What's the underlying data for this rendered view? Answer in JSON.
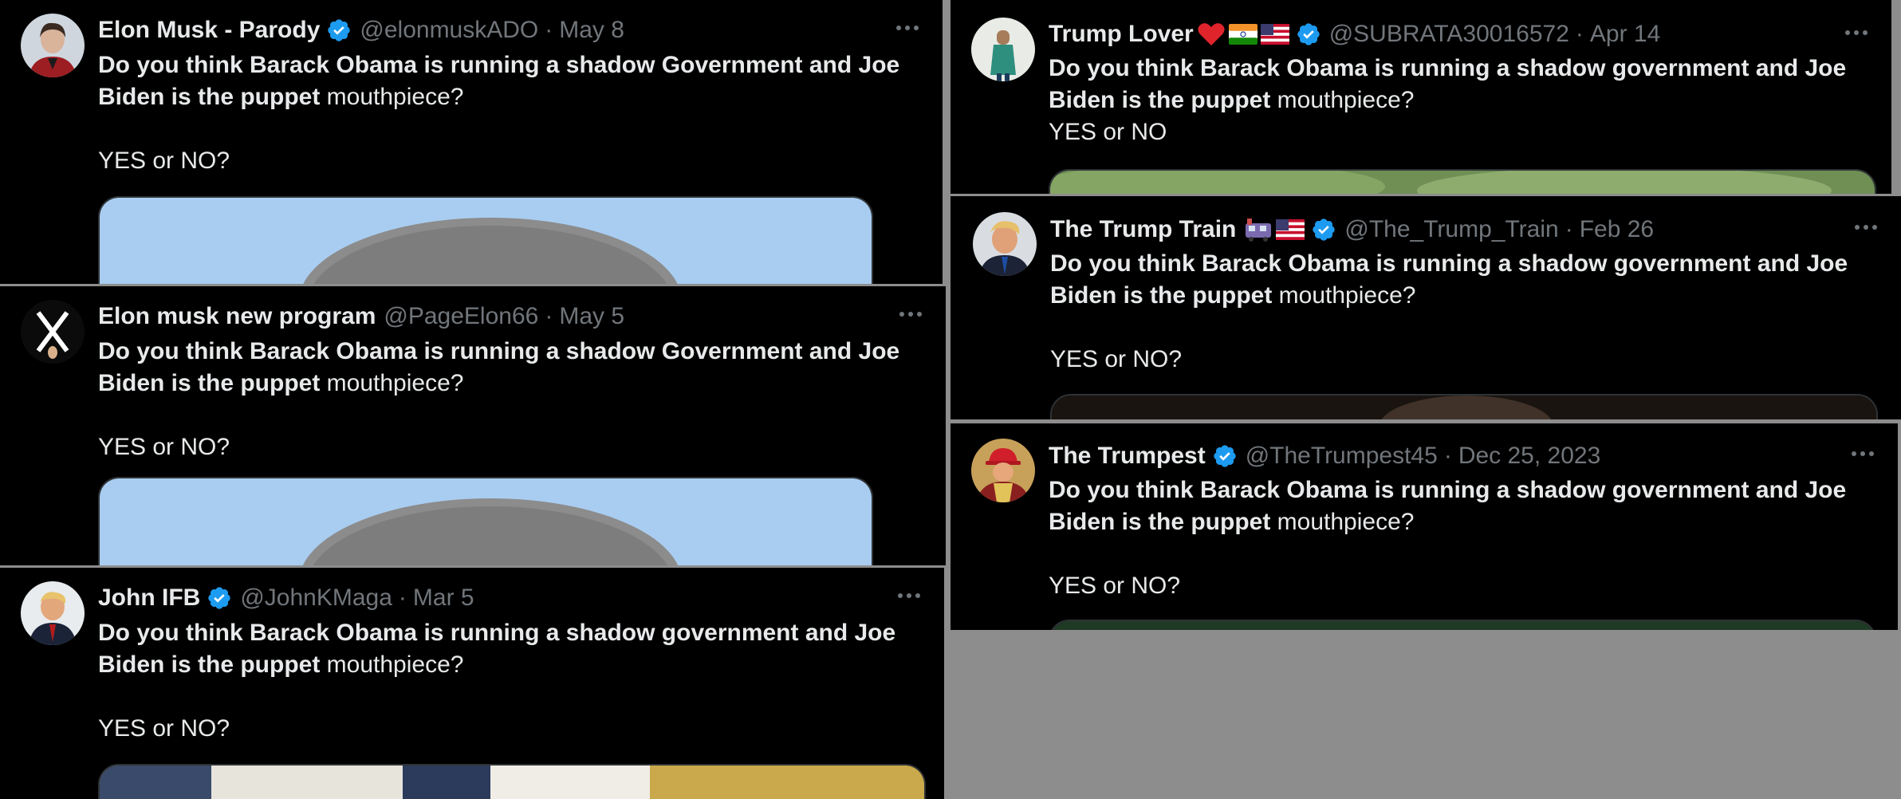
{
  "tweets": [
    {
      "name": "Elon Musk - Parody",
      "handle": "@elonmuskADO",
      "date": "May 8",
      "verified": true,
      "text_bold_1": "Do you think Barack Obama is running a shadow Government and Joe Biden is the puppet",
      "text_rest_1": " mouthpiece?",
      "text_2": "YES or NO?"
    },
    {
      "name": "Elon musk new program",
      "handle": "@PageElon66",
      "date": "May 5",
      "verified": false,
      "text_bold_1": "Do you think Barack Obama is running a shadow Government and Joe Biden is the puppet",
      "text_rest_1": " mouthpiece?",
      "text_2": "YES or NO?"
    },
    {
      "name": "John IFB",
      "handle": "@JohnKMaga",
      "date": "Mar 5",
      "verified": true,
      "text_bold_1": "Do you think Barack Obama is running a shadow government and Joe Biden is the puppet",
      "text_rest_1": " mouthpiece?",
      "text_2": "YES or NO?"
    },
    {
      "name": "Trump Lover",
      "handle": "@SUBRATA30016572",
      "date": "Apr 14",
      "verified": true,
      "text_bold_1": "Do you think Barack Obama is running a shadow government and Joe Biden is the puppet",
      "text_rest_1": " mouthpiece?",
      "text_2": "YES or NO"
    },
    {
      "name": "The Trump Train",
      "handle": "@The_Trump_Train",
      "date": "Feb 26",
      "verified": true,
      "text_bold_1": "Do you think Barack Obama is running a shadow government and Joe Biden is the puppet",
      "text_rest_1": " mouthpiece?",
      "text_2": "YES or NO?"
    },
    {
      "name": "The Trumpest",
      "handle": "@TheTrumpest45",
      "date": "Dec 25, 2023",
      "verified": true,
      "text_bold_1": "Do you think Barack Obama is running a shadow government and Joe Biden is the puppet",
      "text_rest_1": " mouthpiece?",
      "text_2": "YES or NO?"
    }
  ],
  "common": {
    "separator": "·",
    "more_icon": "more-horizontal-icon",
    "verified_icon": "verified-badge-icon"
  },
  "colors": {
    "background": "#000000",
    "text": "#e7e9ea",
    "secondary_text": "#71767b",
    "verified_blue": "#1d9bf0",
    "canvas": "#8d8d8d"
  }
}
